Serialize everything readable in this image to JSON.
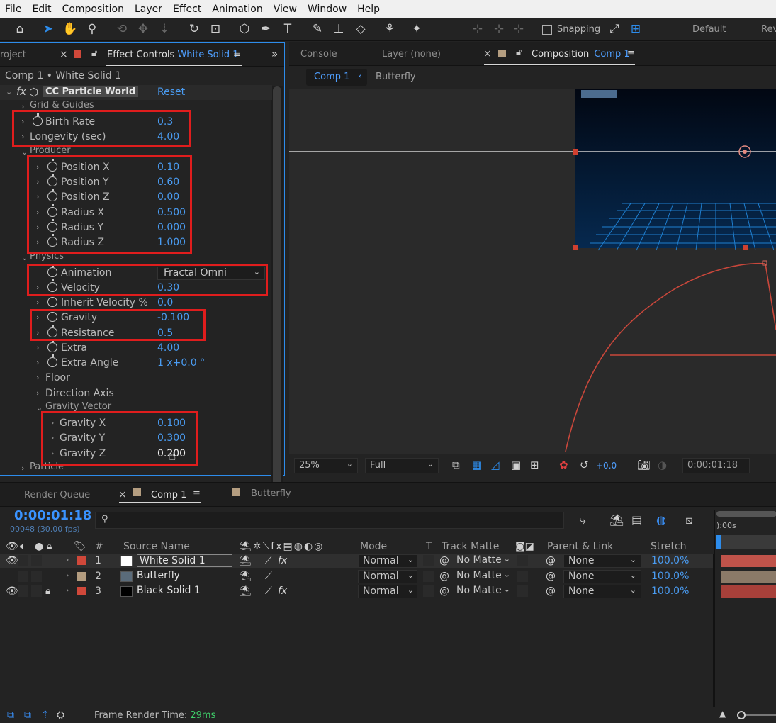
{
  "menu": [
    "File",
    "Edit",
    "Composition",
    "Layer",
    "Effect",
    "Animation",
    "View",
    "Window",
    "Help"
  ],
  "toolbar": {
    "snapping_label": "Snapping",
    "workspace_default": "Default",
    "workspace_review": "Rev"
  },
  "left_panel": {
    "tab_project": "roject",
    "tab_effect_controls": "Effect Controls",
    "tab_effect_layer": "White Solid 1",
    "breadcrumb": "Comp 1 • White Solid 1",
    "effect_name": "CC Particle World",
    "reset_label": "Reset",
    "rows": {
      "grid_guides": "Grid & Guides",
      "birth_rate": {
        "label": "Birth Rate",
        "value": "0.3"
      },
      "longevity": {
        "label": "Longevity (sec)",
        "value": "4.00"
      },
      "producer": "Producer",
      "position_x": {
        "label": "Position X",
        "value": "0.10"
      },
      "position_y": {
        "label": "Position Y",
        "value": "0.60"
      },
      "position_z": {
        "label": "Position Z",
        "value": "0.00"
      },
      "radius_x": {
        "label": "Radius X",
        "value": "0.500"
      },
      "radius_y": {
        "label": "Radius Y",
        "value": "0.000"
      },
      "radius_z": {
        "label": "Radius Z",
        "value": "1.000"
      },
      "physics": "Physics",
      "animation": {
        "label": "Animation",
        "value": "Fractal Omni"
      },
      "velocity": {
        "label": "Velocity",
        "value": "0.30"
      },
      "inherit_velocity": {
        "label": "Inherit Velocity %",
        "value": "0.0"
      },
      "gravity": {
        "label": "Gravity",
        "value": "-0.100"
      },
      "resistance": {
        "label": "Resistance",
        "value": "0.5"
      },
      "extra": {
        "label": "Extra",
        "value": "4.00"
      },
      "extra_angle": {
        "label": "Extra Angle",
        "value": "1 x+0.0 °"
      },
      "floor": "Floor",
      "direction_axis": "Direction Axis",
      "gravity_vector": "Gravity Vector",
      "gravity_x": {
        "label": "Gravity X",
        "value": "0.100"
      },
      "gravity_y": {
        "label": "Gravity Y",
        "value": "0.300"
      },
      "gravity_z": {
        "label": "Gravity Z",
        "value": "0.200"
      },
      "particle": "Particle"
    }
  },
  "right_panel": {
    "tab_console": "Console",
    "tab_layer": "Layer (none)",
    "tab_composition": "Composition",
    "tab_comp_name": "Comp 1",
    "nav_comp1": "Comp 1",
    "nav_butterfly": "Butterfly",
    "zoom": "25%",
    "resolution": "Full",
    "exposure": "+0.0",
    "timecode": "0:00:01:18"
  },
  "timeline": {
    "tab_render_queue": "Render Queue",
    "tab_comp1": "Comp 1",
    "tab_butterfly": "Butterfly",
    "timecode": "0:00:01:18",
    "frame_info": "00048 (30.00 fps)",
    "ruler_start": "):00s",
    "columns": {
      "num": "#",
      "source_name": "Source Name",
      "mode": "Mode",
      "t": "T",
      "track_matte": "Track Matte",
      "parent_link": "Parent & Link",
      "stretch": "Stretch"
    },
    "layers": [
      {
        "num": "1",
        "name": "White Solid 1",
        "label_color": "#d0483a",
        "thumb_color": "#ffffff",
        "mode": "Normal",
        "matte": "No Matte",
        "parent": "None",
        "stretch": "100.0%",
        "bar_color": "#c0534a"
      },
      {
        "num": "2",
        "name": "Butterfly",
        "label_color": "#b49d80",
        "thumb_color": "#5a6b7a",
        "mode": "Normal",
        "matte": "No Matte",
        "parent": "None",
        "stretch": "100.0%",
        "bar_color": "#8b7a68"
      },
      {
        "num": "3",
        "name": "Black Solid 1",
        "label_color": "#d0483a",
        "thumb_color": "#000000",
        "mode": "Normal",
        "matte": "No Matte",
        "parent": "None",
        "stretch": "100.0%",
        "bar_color": "#a8403a"
      }
    ]
  },
  "status": {
    "frame_render_label": "Frame Render Time:",
    "frame_render_value": "29ms"
  },
  "colors": {
    "accent": "#2d8ceb",
    "value_blue": "#4a9cf2",
    "highlight_red": "#e01d1d",
    "grid_blue": "#1f7fd0",
    "motion_path": "#c9473b"
  }
}
